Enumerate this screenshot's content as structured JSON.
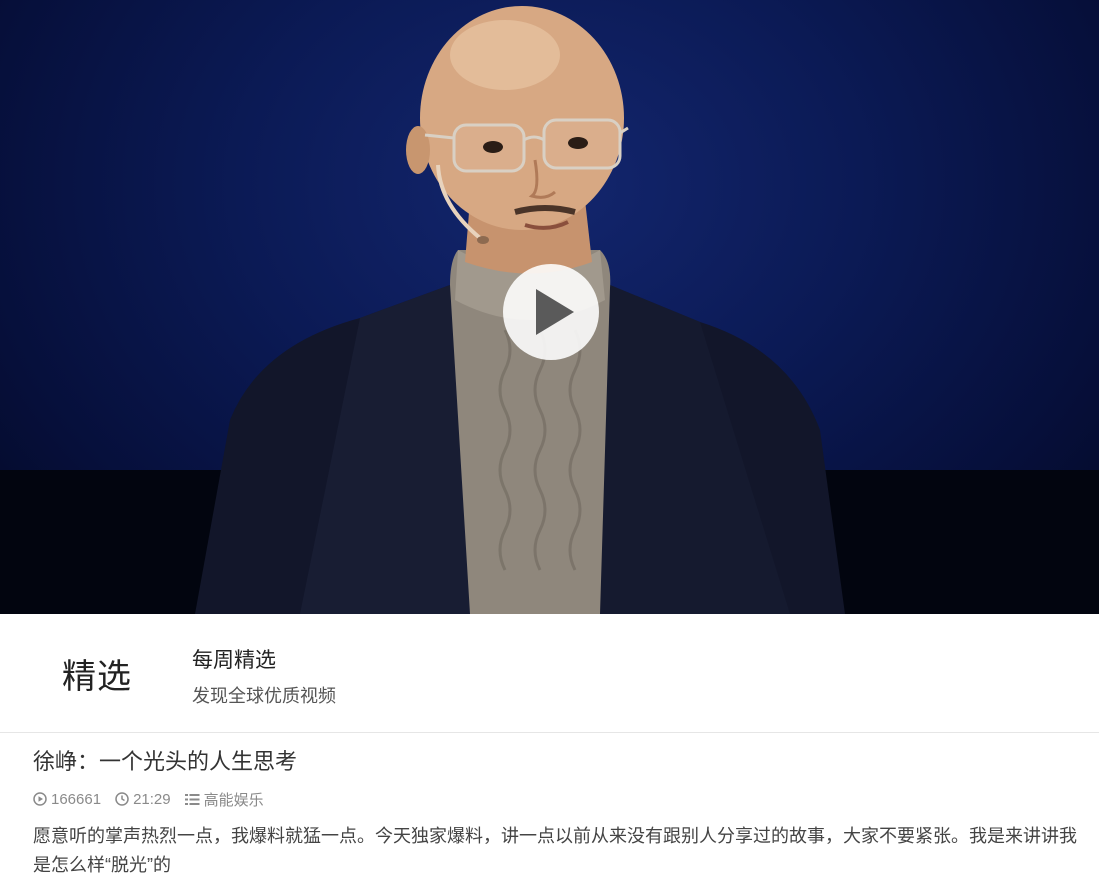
{
  "video": {
    "thumbnail_icon": "speaker-portrait",
    "play_icon": "play-icon"
  },
  "channel": {
    "logo_text": "精选",
    "name": "每周精选",
    "description": "发现全球优质视频"
  },
  "post": {
    "title": "徐峥：一个光头的人生思考",
    "views": "166661",
    "duration": "21:29",
    "category": "高能娱乐",
    "description": "愿意听的掌声热烈一点，我爆料就猛一点。今天独家爆料，讲一点以前从来没有跟别人分享过的故事，大家不要紧张。我是来讲讲我是怎么样“脱光”的"
  },
  "colors": {
    "stage_blue": "#0b1a55",
    "meta_gray": "#8a8a8a",
    "text_dark": "#333333"
  }
}
